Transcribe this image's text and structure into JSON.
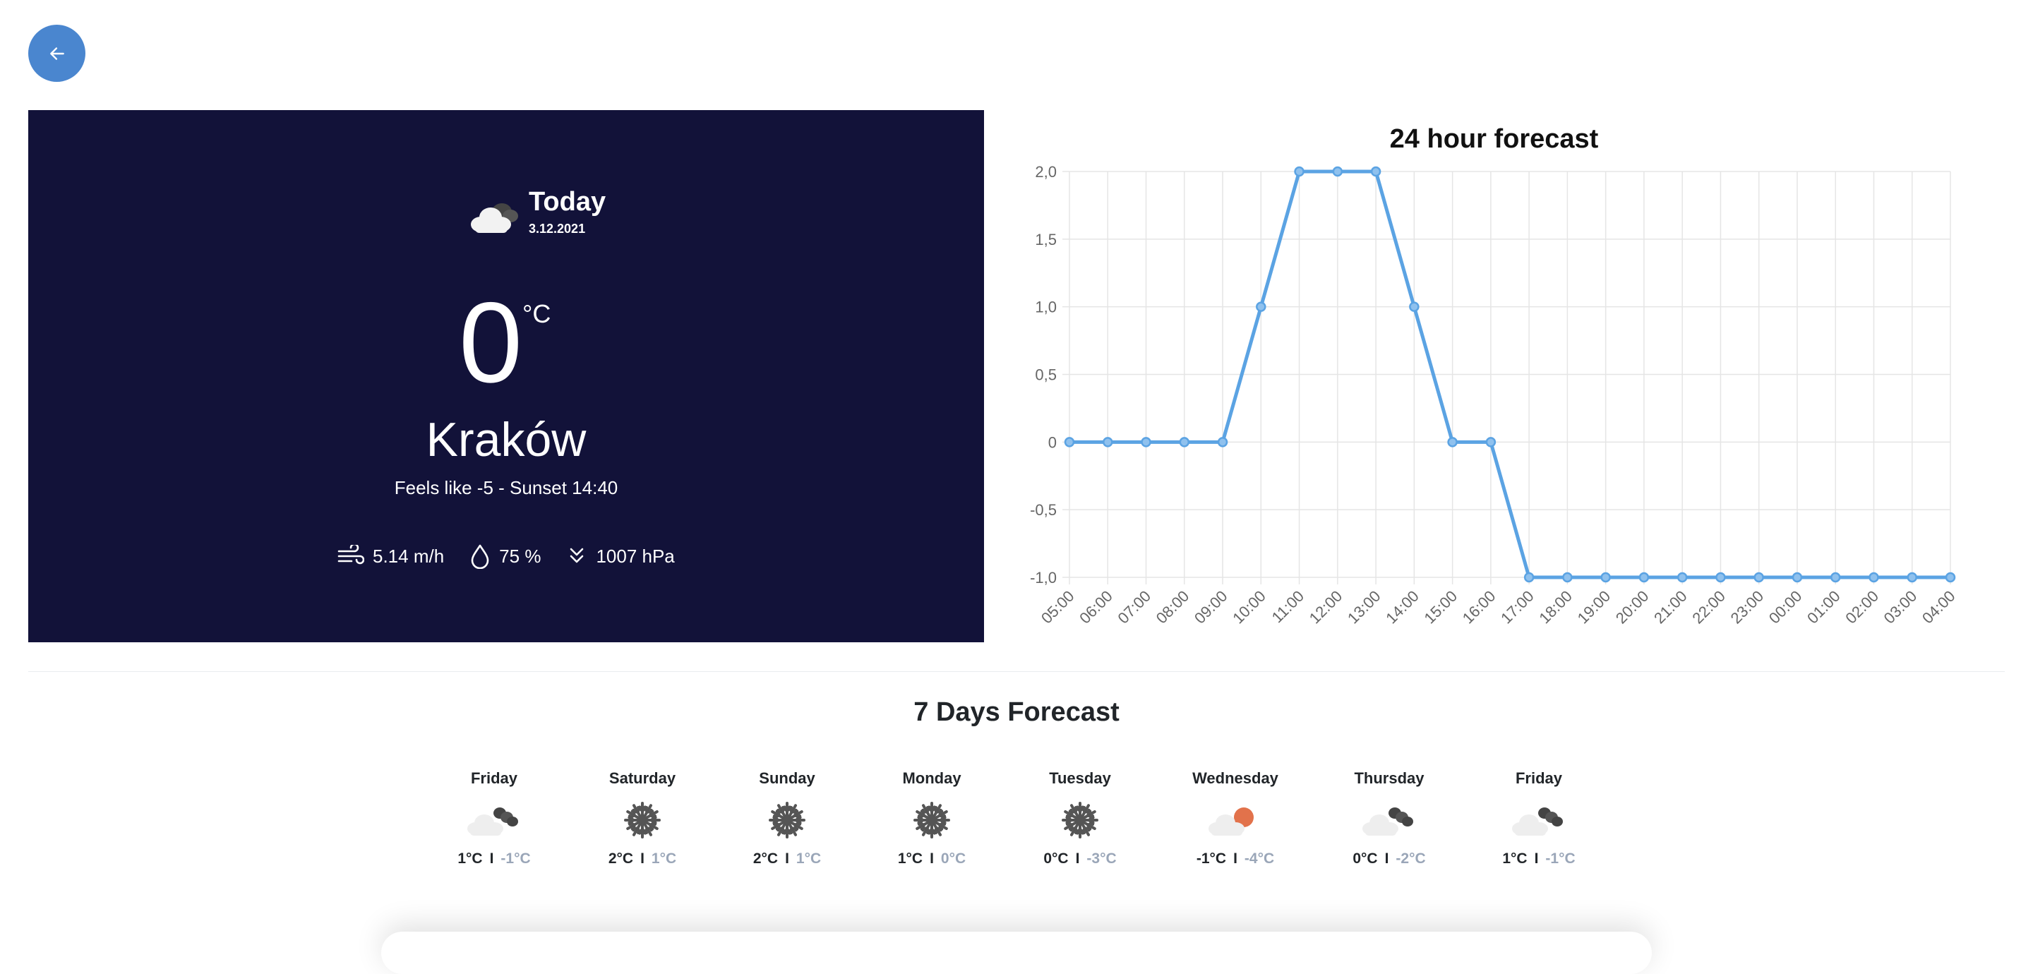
{
  "nav": {
    "back_icon": "arrow-left-icon"
  },
  "today": {
    "title": "Today",
    "date": "3.12.2021",
    "icon": "cloudy-icon",
    "temperature": "0",
    "unit": "°C",
    "city": "Kraków",
    "feels_line": "Feels like -5 - Sunset 14:40",
    "wind": "5.14 m/h",
    "humidity": "75 %",
    "pressure": "1007 hPa"
  },
  "colors": {
    "panel_bg": "#121239",
    "accent": "#4a86cf",
    "line": "#5ba3e3",
    "low_temp": "#9aa6b8"
  },
  "chart_data": {
    "type": "line",
    "title": "24 hour forecast",
    "categories": [
      "05:00",
      "06:00",
      "07:00",
      "08:00",
      "09:00",
      "10:00",
      "11:00",
      "12:00",
      "13:00",
      "14:00",
      "15:00",
      "16:00",
      "17:00",
      "18:00",
      "19:00",
      "20:00",
      "21:00",
      "22:00",
      "23:00",
      "00:00",
      "01:00",
      "02:00",
      "03:00",
      "04:00"
    ],
    "values": [
      0,
      0,
      0,
      0,
      0,
      1,
      2,
      2,
      2,
      1,
      0,
      0,
      -1,
      -1,
      -1,
      -1,
      -1,
      -1,
      -1,
      -1,
      -1,
      -1,
      -1,
      -1
    ],
    "y_ticks": [
      "2,0",
      "1,5",
      "1,0",
      "0,5",
      "0",
      "-0,5",
      "-1,0"
    ],
    "ylim": [
      -1,
      2
    ],
    "grid": true
  },
  "week": {
    "title": "7 Days Forecast",
    "days": [
      {
        "name": "Friday",
        "icon": "cloud-night-icon",
        "high": "1°C",
        "low": "-1°C"
      },
      {
        "name": "Saturday",
        "icon": "snowflake-icon",
        "high": "2°C",
        "low": "1°C"
      },
      {
        "name": "Sunday",
        "icon": "snowflake-icon",
        "high": "2°C",
        "low": "1°C"
      },
      {
        "name": "Monday",
        "icon": "snowflake-icon",
        "high": "1°C",
        "low": "0°C"
      },
      {
        "name": "Tuesday",
        "icon": "snowflake-icon",
        "high": "0°C",
        "low": "-3°C"
      },
      {
        "name": "Wednesday",
        "icon": "cloud-sun-icon",
        "high": "-1°C",
        "low": "-4°C"
      },
      {
        "name": "Thursday",
        "icon": "cloud-night-icon",
        "high": "0°C",
        "low": "-2°C"
      },
      {
        "name": "Friday",
        "icon": "cloud-night-icon",
        "high": "1°C",
        "low": "-1°C"
      }
    ]
  }
}
